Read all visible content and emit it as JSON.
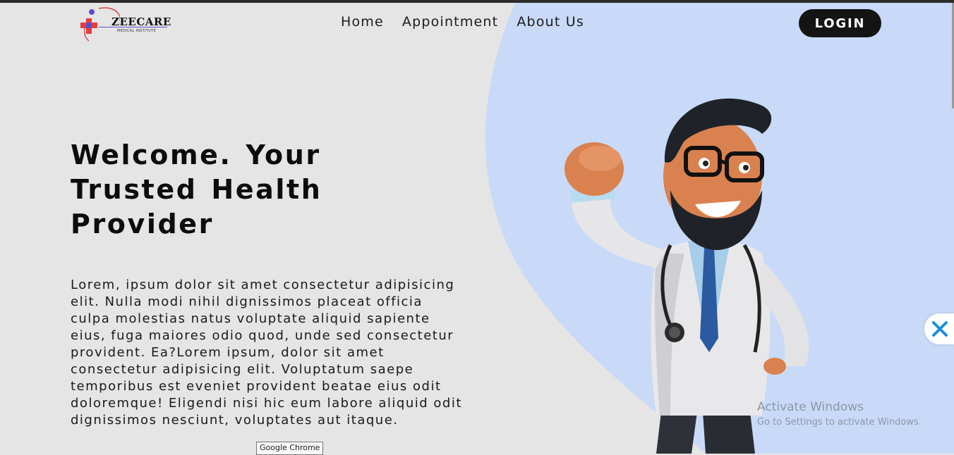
{
  "brand": {
    "name": "ZEECARE",
    "tagline": "MEDICAL INSTITUTE"
  },
  "nav": {
    "items": [
      "Home",
      "Appointment",
      "About Us"
    ],
    "login_label": "LOGIN"
  },
  "hero": {
    "title": "Welcome. Your Trusted Health Provider",
    "body": "Lorem, ipsum dolor sit amet consectetur adipisicing elit. Nulla modi nihil dignissimos placeat officia culpa molestias natus voluptate aliquid sapiente eius, fuga maiores odio quod, unde sed consectetur provident. Ea?Lorem ipsum, dolor sit amet consectetur adipisicing elit. Voluptatum saepe temporibus est eveniet provident beatae eius odit doloremque! Eligendi nisi hic eum labore aliquid odit dignissimos nesciunt, voluptates aut itaque."
  },
  "watermark": {
    "title": "Activate Windows",
    "subtitle": "Go to Settings to activate Windows."
  },
  "tooltip": "Google Chrome",
  "colors": {
    "background": "#e5e5e5",
    "accent_blob": "#c8daf7",
    "button": "#141414",
    "text": "#0c0c0c"
  },
  "icons": {
    "logo": "medical-cross-logo",
    "widget": "sparkle-icon"
  }
}
